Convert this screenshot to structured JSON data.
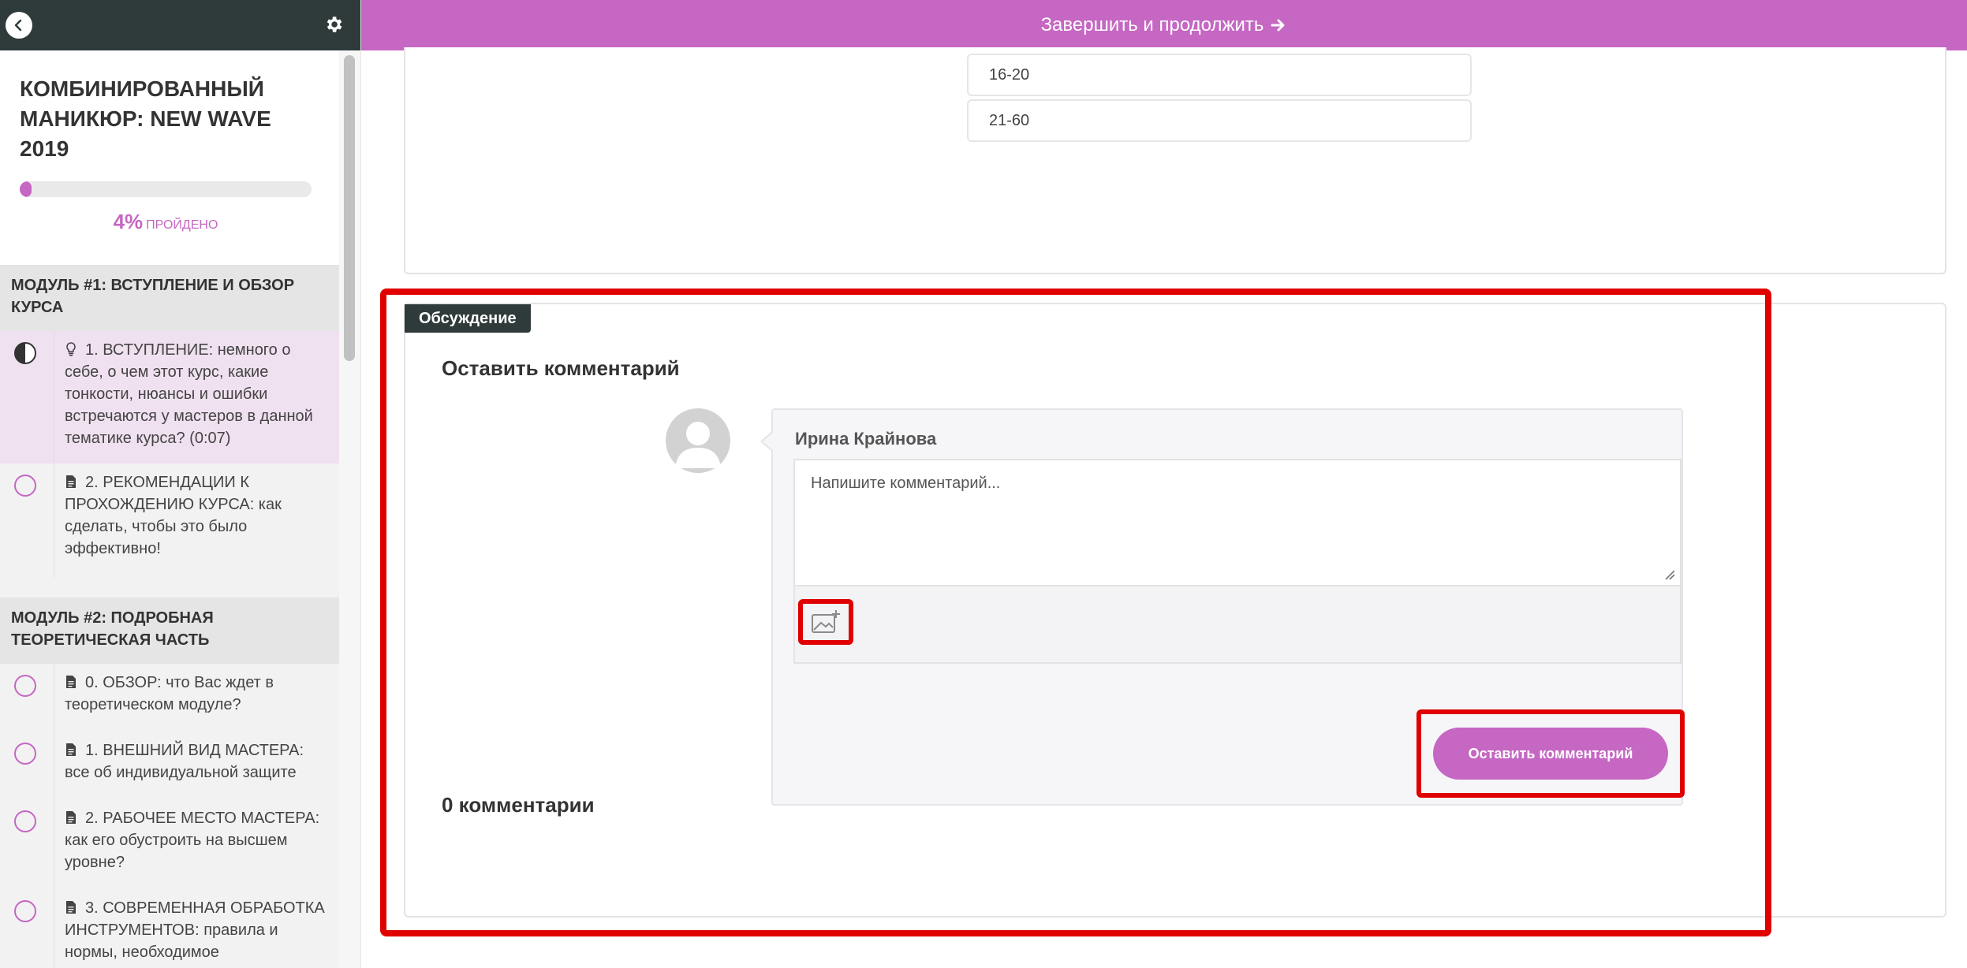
{
  "sidebar": {
    "course_title": "Комбинированный маникюр: NEW WAVE 2019",
    "progress": {
      "percent_value": 4,
      "percent_text": "4%",
      "label": "пройдено"
    },
    "modules": [
      {
        "title": "Модуль #1: Вступление и обзор курса",
        "lessons": [
          {
            "text": "1. ВСТУПЛЕНИЕ: немного о себе, о чем этот курс, какие тонкости, нюансы и ошибки встречаются у мастеров в данной тематике курса? (0:07)",
            "icon": "lightbulb-icon",
            "status": "in-progress",
            "active": true
          },
          {
            "text": "2. РЕКОМЕНДАЦИИ К ПРОХОЖДЕНИЮ КУРСА: как сделать, чтобы это было эффективно!",
            "icon": "document-icon",
            "status": "not-started",
            "active": false
          }
        ]
      },
      {
        "title": "Модуль #2: Подробная теоретическая часть",
        "lessons": [
          {
            "text": "0. ОБЗОР: что Вас ждет в теоретическом модуле?",
            "icon": "document-icon",
            "status": "not-started"
          },
          {
            "text": "1. ВНЕШНИЙ ВИД МАСТЕРА: все об индивидуальной защите",
            "icon": "document-icon",
            "status": "not-started"
          },
          {
            "text": "2. РАБОЧЕЕ МЕСТО МАСТЕРА: как его обустроить на высшем уровне?",
            "icon": "document-icon",
            "status": "not-started"
          },
          {
            "text": "3. СОВРЕМЕННАЯ ОБРАБОТКА ИНСТРУМЕНТОВ: правила и нормы, необходимое",
            "icon": "document-icon",
            "status": "not-started"
          }
        ]
      }
    ]
  },
  "top_bar": {
    "label": "Завершить и продолжить",
    "icon": "arrow-right-icon"
  },
  "quiz": {
    "options": [
      "16-20",
      "21-60"
    ]
  },
  "discussion": {
    "badge": "Обсуждение",
    "leave_comment_title": "Оставить комментарий",
    "user_name": "Ирина Крайнова",
    "textarea_placeholder": "Напишите комментарий...",
    "submit_label": "Оставить комментарий",
    "comments_count_label": "0 комментарии"
  },
  "colors": {
    "accent": "#c567c3",
    "dark": "#2f3a3a",
    "highlight": "#e00000"
  }
}
